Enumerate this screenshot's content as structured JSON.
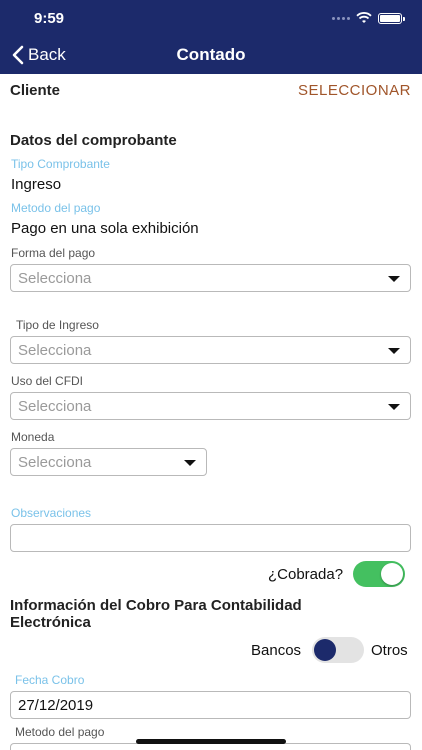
{
  "status": {
    "time": "9:59"
  },
  "nav": {
    "back_label": "Back",
    "title": "Contado"
  },
  "cliente": {
    "label": "Cliente",
    "action": "SELECCIONAR"
  },
  "comprobante": {
    "heading": "Datos del comprobante",
    "tipo_label": "Tipo Comprobante",
    "tipo_value": "Ingreso",
    "metodo_label": "Metodo del pago",
    "metodo_value": "Pago en una sola exhibición"
  },
  "forma_pago": {
    "label": "Forma del pago",
    "placeholder": "Selecciona"
  },
  "tipo_ingreso": {
    "label": "Tipo de Ingreso",
    "placeholder": "Selecciona"
  },
  "uso_cfdi": {
    "label": "Uso del CFDI",
    "placeholder": "Selecciona"
  },
  "moneda": {
    "label": "Moneda",
    "placeholder": "Selecciona"
  },
  "observaciones": {
    "label": "Observaciones",
    "value": ""
  },
  "cobrada": {
    "label": "¿Cobrada?",
    "on": true
  },
  "cobro": {
    "heading_line1": "Información del Cobro Para Contabilidad",
    "heading_line2": "Electrónica",
    "left_option": "Bancos",
    "right_option": "Otros",
    "fecha_label": "Fecha Cobro",
    "fecha_value": "27/12/2019",
    "metodo_label": "Metodo del pago"
  },
  "colors": {
    "nav": "#1c2a6b",
    "link": "#a0552a",
    "label_blue": "#7ac2e9",
    "toggle_on": "#44c060"
  },
  "icons": [
    "back-chevron-icon",
    "dropdown-caret-icon",
    "wifi-icon",
    "battery-icon",
    "signal-icon"
  ]
}
